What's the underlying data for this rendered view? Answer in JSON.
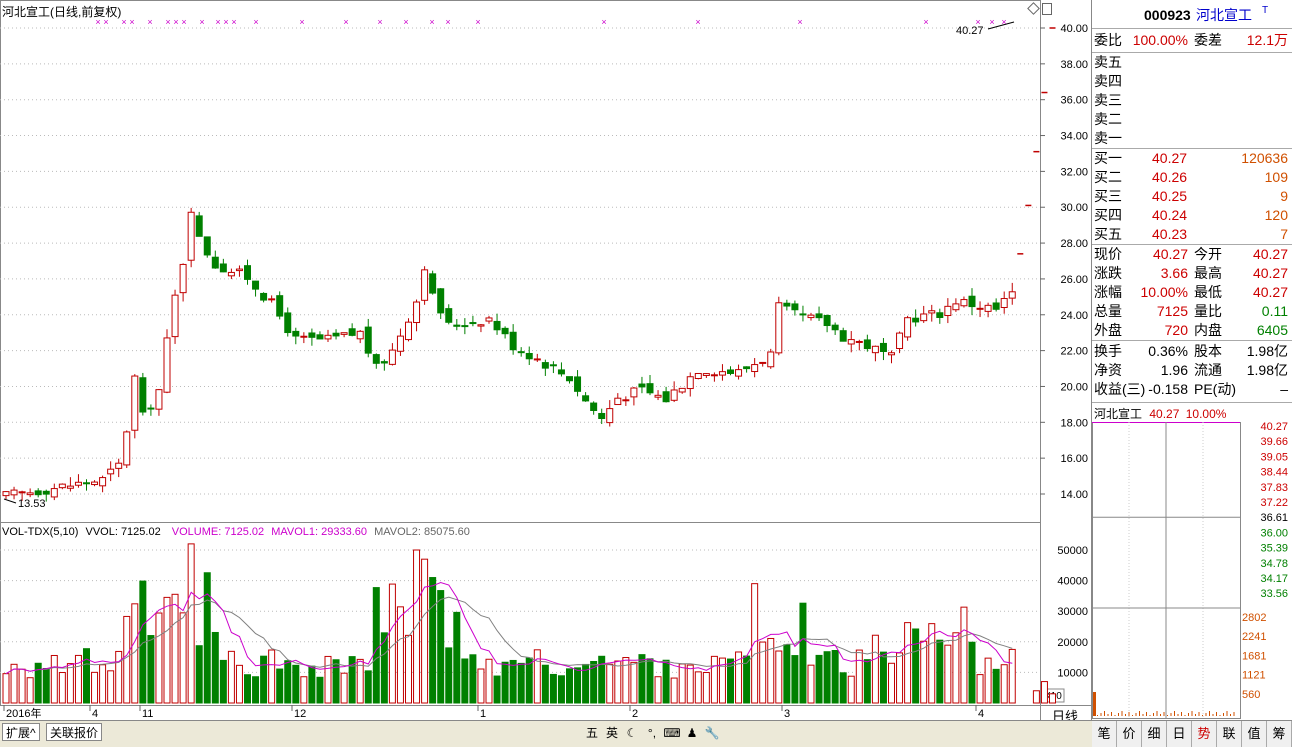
{
  "chart_title": "河北宣工(日线,前复权)",
  "price_axis_ticks": [
    "40.00",
    "38.00",
    "36.00",
    "34.00",
    "32.00",
    "30.00",
    "28.00",
    "26.00",
    "24.00",
    "22.00",
    "20.00",
    "18.00",
    "16.00",
    "14.00"
  ],
  "low_marker": "13.53",
  "high_marker": "40.27",
  "volume_legend": {
    "name": "VOL-TDX(5,10)",
    "vvol": "VVOL: 7125.02",
    "volume": "VOLUME: 7125.02",
    "mavol1": "MAVOL1: 29333.60",
    "mavol2": "MAVOL2: 85075.60"
  },
  "volume_axis_ticks": [
    "50000",
    "40000",
    "30000",
    "20000",
    "10000"
  ],
  "volume_unit": "X10",
  "date_axis": [
    "2016年",
    "4",
    "11",
    "12",
    "1",
    "2",
    "3",
    "4"
  ],
  "period_label": "日线",
  "colors": {
    "up": "#c00000",
    "down": "#008000",
    "ma1": "#cc00cc",
    "ma2": "#808080",
    "signal": "#cc00cc"
  },
  "quote": {
    "code": "000923",
    "name": "河北宣工",
    "flag": "T",
    "weibi_label": "委比",
    "weibi": "100.00%",
    "weicha_label": "委差",
    "weicha": "12.1万",
    "sell": [
      {
        "label": "卖五"
      },
      {
        "label": "卖四"
      },
      {
        "label": "卖三"
      },
      {
        "label": "卖二"
      },
      {
        "label": "卖一"
      }
    ],
    "buy": [
      {
        "label": "买一",
        "price": "40.27",
        "vol": "120636"
      },
      {
        "label": "买二",
        "price": "40.26",
        "vol": "109"
      },
      {
        "label": "买三",
        "price": "40.25",
        "vol": "9"
      },
      {
        "label": "买四",
        "price": "40.24",
        "vol": "120"
      },
      {
        "label": "买五",
        "price": "40.23",
        "vol": "7"
      }
    ],
    "stats": [
      {
        "l1": "现价",
        "v1": "40.27",
        "l2": "今开",
        "v2": "40.27",
        "c2": ""
      },
      {
        "l1": "涨跌",
        "v1": "3.66",
        "l2": "最高",
        "v2": "40.27",
        "c2": ""
      },
      {
        "l1": "涨幅",
        "v1": "10.00%",
        "l2": "最低",
        "v2": "40.27",
        "c2": ""
      },
      {
        "l1": "总量",
        "v1": "7125",
        "l2": "量比",
        "v2": "0.11",
        "c2": "grn"
      },
      {
        "l1": "外盘",
        "v1": "720",
        "l2": "内盘",
        "v2": "6405",
        "c2": "grn"
      }
    ],
    "stats2": [
      {
        "l1": "换手",
        "v1": "0.36%",
        "l2": "股本",
        "v2": "1.98亿"
      },
      {
        "l1": "净资",
        "v1": "1.96",
        "l2": "流通",
        "v2": "1.98亿"
      },
      {
        "l1": "收益(三)",
        "v1": "-0.158",
        "l2": "PE(动)",
        "v2": "–"
      }
    ]
  },
  "mini_chart": {
    "title": "河北宣工",
    "price": "40.27",
    "pct": "10.00%",
    "price_ticks": [
      "40.27",
      "39.66",
      "39.05",
      "38.44",
      "37.83",
      "37.22",
      "36.61",
      "36.00",
      "35.39",
      "34.78",
      "34.17",
      "33.56"
    ],
    "vol_ticks": [
      "2802",
      "2241",
      "1681",
      "1121",
      "560"
    ]
  },
  "bottom_tabs": [
    "笔",
    "价",
    "细",
    "日",
    "势",
    "联",
    "值",
    "筹"
  ],
  "active_tab": "势",
  "status_buttons": [
    "扩展^",
    "关联报价"
  ],
  "ime_icons": [
    "五",
    "英",
    "☾",
    "°,",
    "⌨",
    "♟",
    "🔧"
  ]
}
